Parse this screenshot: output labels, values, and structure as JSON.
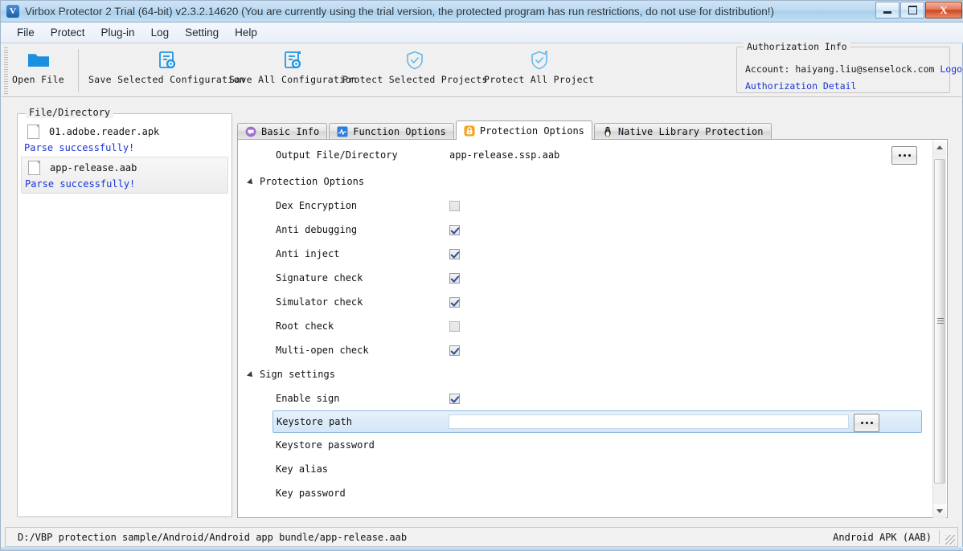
{
  "window": {
    "icon": "app-logo-icon",
    "icon_letter": "V",
    "title": "Virbox Protector 2 Trial (64-bit) v2.3.2.14620  (You are currently using the trial version, the protected program has run restrictions, do not use for distribution!)",
    "minimize_label": "Minimize",
    "maximize_label": "Maximize",
    "close_label": "X"
  },
  "menu": {
    "items": [
      {
        "label": "File"
      },
      {
        "label": "Protect"
      },
      {
        "label": "Plug-in"
      },
      {
        "label": "Log"
      },
      {
        "label": "Setting"
      },
      {
        "label": "Help"
      }
    ]
  },
  "toolbar": {
    "buttons": [
      {
        "label": "Open File",
        "icon": "open-folder-icon"
      },
      {
        "label": "Save Selected Configuration",
        "icon": "document-gear-icon"
      },
      {
        "label": "Save All Configuration",
        "icon": "document-gear-all-icon"
      },
      {
        "label": "Protect Selected Projects",
        "icon": "shield-check-icon"
      },
      {
        "label": "Protect All Project",
        "icon": "shield-check-all-icon"
      }
    ]
  },
  "authorization": {
    "legend": "Authorization Info",
    "account_label": "Account:",
    "account_value": "haiyang.liu@senselock.com",
    "logout_label": "Logout",
    "detail_label": "Authorization Detail",
    "link_color": "#1832d8"
  },
  "file_panel": {
    "legend": "File/Directory",
    "items": [
      {
        "name": "01.adobe.reader.apk",
        "status": "Parse successfully!",
        "selected": false,
        "icon": "file-icon"
      },
      {
        "name": "app-release.aab",
        "status": "Parse successfully!",
        "selected": true,
        "icon": "file-icon"
      }
    ]
  },
  "tabs": [
    {
      "label": "Basic Info",
      "icon": "speech-bubble-icon",
      "icon_color": "#9a6fd0",
      "active": false
    },
    {
      "label": "Function Options",
      "icon": "waveform-icon",
      "icon_color": "#2f7ed8",
      "active": false
    },
    {
      "label": "Protection Options",
      "icon": "padlock-icon",
      "icon_color": "#f5a21d",
      "active": true
    },
    {
      "label": "Native Library Protection",
      "icon": "penguin-icon",
      "icon_color": "#f0b323",
      "active": false
    }
  ],
  "protection_panel": {
    "output_row": {
      "label": "Output File/Directory",
      "value": "app-release.ssp.aab",
      "browse_label": "..."
    },
    "groups": [
      {
        "label": "Protection Options",
        "expanded": true,
        "rows": [
          {
            "label": "Dex Encryption",
            "checked": false,
            "disabled": true
          },
          {
            "label": "Anti debugging",
            "checked": true,
            "disabled": false
          },
          {
            "label": "Anti inject",
            "checked": true,
            "disabled": false
          },
          {
            "label": "Signature check",
            "checked": true,
            "disabled": false
          },
          {
            "label": "Simulator check",
            "checked": true,
            "disabled": false
          },
          {
            "label": "Root check",
            "checked": false,
            "disabled": true
          },
          {
            "label": "Multi-open check",
            "checked": true,
            "disabled": false
          }
        ]
      },
      {
        "label": "Sign settings",
        "expanded": true,
        "rows": [
          {
            "label": "Enable sign",
            "checked": true,
            "disabled": false
          }
        ]
      }
    ],
    "keystore_row": {
      "label": "Keystore path",
      "value": "",
      "selected": true,
      "browse_label": "..."
    },
    "text_rows": [
      {
        "label": "Keystore password",
        "value": ""
      },
      {
        "label": "Key alias",
        "value": ""
      },
      {
        "label": "Key password",
        "value": ""
      }
    ]
  },
  "statusbar": {
    "path": "D:/VBP protection sample/Android/Android app bundle/app-release.aab",
    "file_type": "Android APK (AAB)"
  }
}
